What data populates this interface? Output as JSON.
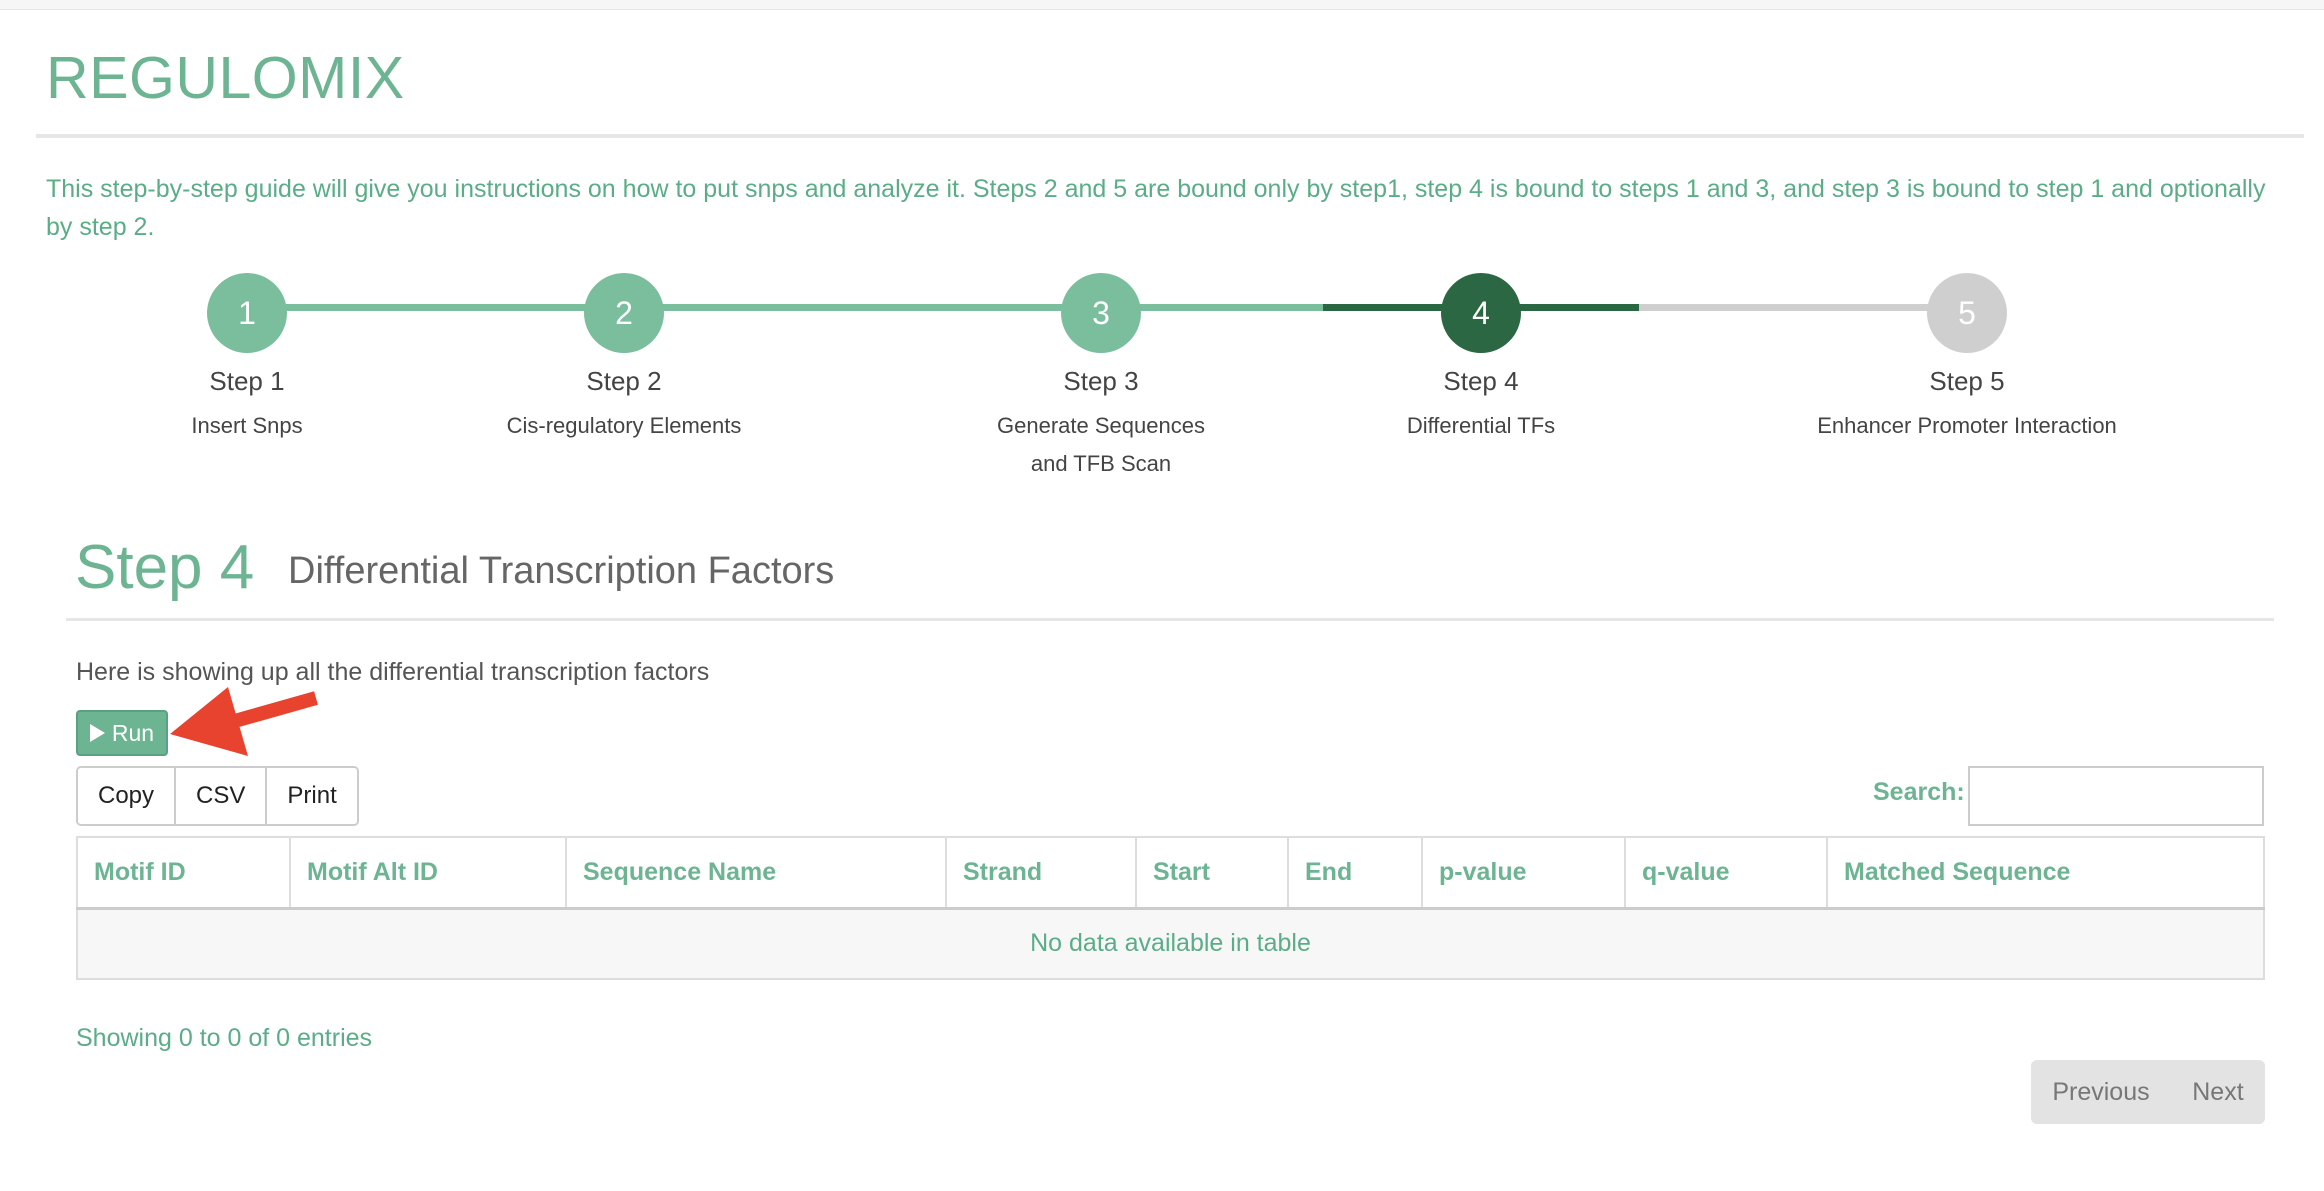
{
  "app": {
    "title": "REGULOMIX"
  },
  "guide": {
    "text": "This step-by-step guide will give you instructions on how to put snps and analyze it. Steps 2 and 5 are bound only by step1, step 4 is bound to steps 1 and 3, and step 3 is bound to step 1 and optionally by step 2."
  },
  "stepper": {
    "steps": [
      {
        "number": "1",
        "label": "Step 1",
        "desc": "Insert Snps",
        "state": "done"
      },
      {
        "number": "2",
        "label": "Step 2",
        "desc": "Cis-regulatory Elements",
        "state": "done"
      },
      {
        "number": "3",
        "label": "Step 3",
        "desc_line1": "Generate Sequences",
        "desc_line2": "and TFB Scan",
        "state": "done"
      },
      {
        "number": "4",
        "label": "Step 4",
        "desc": "Differential TFs",
        "state": "active"
      },
      {
        "number": "5",
        "label": "Step 5",
        "desc": "Enhancer Promoter Interaction",
        "state": "todo"
      }
    ],
    "colors": {
      "done": "#7bbe9e",
      "active": "#2b6742",
      "todo": "#cfcfcf"
    }
  },
  "section": {
    "title": "Step 4",
    "subtitle": "Differential Transcription Factors",
    "intro": "Here is showing up all the differential transcription factors"
  },
  "toolbar": {
    "run_label": "Run",
    "copy_label": "Copy",
    "csv_label": "CSV",
    "print_label": "Print",
    "search_label": "Search:",
    "search_value": ""
  },
  "table": {
    "columns": [
      "Motif ID",
      "Motif Alt ID",
      "Sequence Name",
      "Strand",
      "Start",
      "End",
      "p-value",
      "q-value",
      "Matched Sequence"
    ],
    "empty_message": "No data available in table"
  },
  "footer": {
    "info": "Showing 0 to 0 of 0 entries",
    "previous_label": "Previous",
    "next_label": "Next"
  },
  "colors": {
    "accent": "#6db493",
    "accent_dark": "#2b6742",
    "annotation_arrow": "#e8432e"
  }
}
